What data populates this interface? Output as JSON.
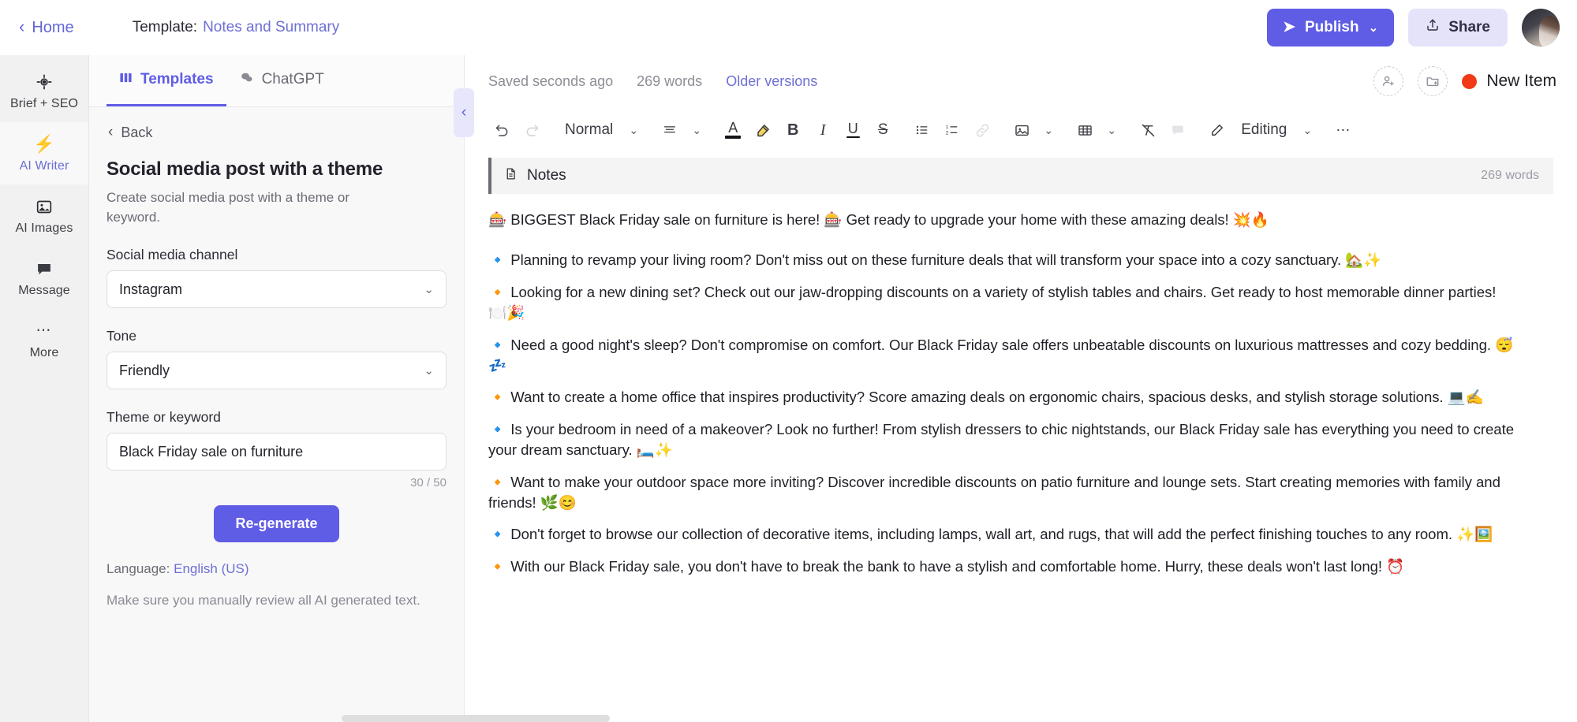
{
  "topbar": {
    "home_label": "Home",
    "back_icon": "chevron-left-icon",
    "template_prefix": "Template:",
    "template_name": "Notes and Summary",
    "publish_label": "Publish",
    "publish_icon": "send-icon",
    "publish_caret": "chevron-down-icon",
    "share_label": "Share",
    "share_icon": "upload-icon",
    "accent_color": "#5f5ce6",
    "share_bg": "#e4e3fa"
  },
  "rail": {
    "items": [
      {
        "label": "Brief + SEO",
        "icon": "target-icon",
        "active": false
      },
      {
        "label": "AI Writer",
        "icon": "lightning-icon",
        "active": true
      },
      {
        "label": "AI Images",
        "icon": "image-icon",
        "active": false
      },
      {
        "label": "Message",
        "icon": "chat-bubble-icon",
        "active": false
      },
      {
        "label": "More",
        "icon": "ellipsis-icon",
        "active": false
      }
    ]
  },
  "panel": {
    "tabs": [
      {
        "label": "Templates",
        "icon": "templates-grid-icon",
        "active": true
      },
      {
        "label": "ChatGPT",
        "icon": "chat-bubbles-icon",
        "active": false
      }
    ],
    "back_label": "Back",
    "title": "Social media post with a theme",
    "description": "Create social media post with a theme or keyword.",
    "fields": [
      {
        "label": "Social media channel",
        "value": "Instagram",
        "type": "select"
      },
      {
        "label": "Tone",
        "value": "Friendly",
        "type": "select"
      },
      {
        "label": "Theme or keyword",
        "value": "Black Friday sale on furniture",
        "type": "input",
        "counter": "30 / 50"
      }
    ],
    "regenerate_label": "Re-generate",
    "language_prefix": "Language:",
    "language_value": "English (US)",
    "disclaimer": "Make sure you manually review all AI generated text.",
    "collapse_icon": "chevron-left-icon"
  },
  "editor": {
    "saved_status": "Saved seconds ago",
    "word_count": "269 words",
    "older_versions": "Older versions",
    "invite_icon": "add-person-icon",
    "folder_icon": "add-folder-icon",
    "status_dot_color": "#f03a17",
    "status_label": "New Item",
    "toolbar": {
      "undo": "undo-icon",
      "redo": "redo-icon",
      "style_label": "Normal",
      "style_caret": "chevron-down-icon",
      "align": "align-icon",
      "align_caret": "chevron-down-icon",
      "text_color": "text-color-icon",
      "highlight": "highlighter-icon",
      "bold": "B",
      "italic": "I",
      "underline": "U",
      "strike": "S",
      "bullet_list": "bullet-list-icon",
      "numbered_list": "numbered-list-icon",
      "link": "link-icon",
      "image": "image-icon",
      "image_caret": "chevron-down-icon",
      "table": "table-icon",
      "table_caret": "chevron-down-icon",
      "clear_format": "clear-format-icon",
      "comment": "comment-icon",
      "mode_icon": "pencil-icon",
      "mode_label": "Editing",
      "mode_caret": "chevron-down-icon",
      "more": "ellipsis-icon"
    },
    "notes_block": {
      "icon": "document-icon",
      "title": "Notes",
      "word_count": "269 words"
    },
    "document": {
      "paragraphs": [
        "🎰 BIGGEST Black Friday sale on furniture is here! 🎰 Get ready to upgrade your home with these amazing deals! 💥🔥",
        "🔹 Planning to revamp your living room? Don't miss out on these furniture deals that will transform your space into a cozy sanctuary. 🏡✨",
        "🔸 Looking for a new dining set? Check out our jaw-dropping discounts on a variety of stylish tables and chairs. Get ready to host memorable dinner parties! 🍽️🎉",
        "🔹 Need a good night's sleep? Don't compromise on comfort. Our Black Friday sale offers unbeatable discounts on luxurious mattresses and cozy bedding. 😴💤",
        "🔸 Want to create a home office that inspires productivity? Score amazing deals on ergonomic chairs, spacious desks, and stylish storage solutions. 💻✍️",
        "🔹 Is your bedroom in need of a makeover? Look no further! From stylish dressers to chic nightstands, our Black Friday sale has everything you need to create your dream sanctuary. 🛏️✨",
        "🔸 Want to make your outdoor space more inviting? Discover incredible discounts on patio furniture and lounge sets. Start creating memories with family and friends! 🌿😊",
        "🔹 Don't forget to browse our collection of decorative items, including lamps, wall art, and rugs, that will add the perfect finishing touches to any room. ✨🖼️",
        "🔸 With our Black Friday sale, you don't have to break the bank to have a stylish and comfortable home. Hurry, these deals won't last long! ⏰"
      ]
    }
  }
}
